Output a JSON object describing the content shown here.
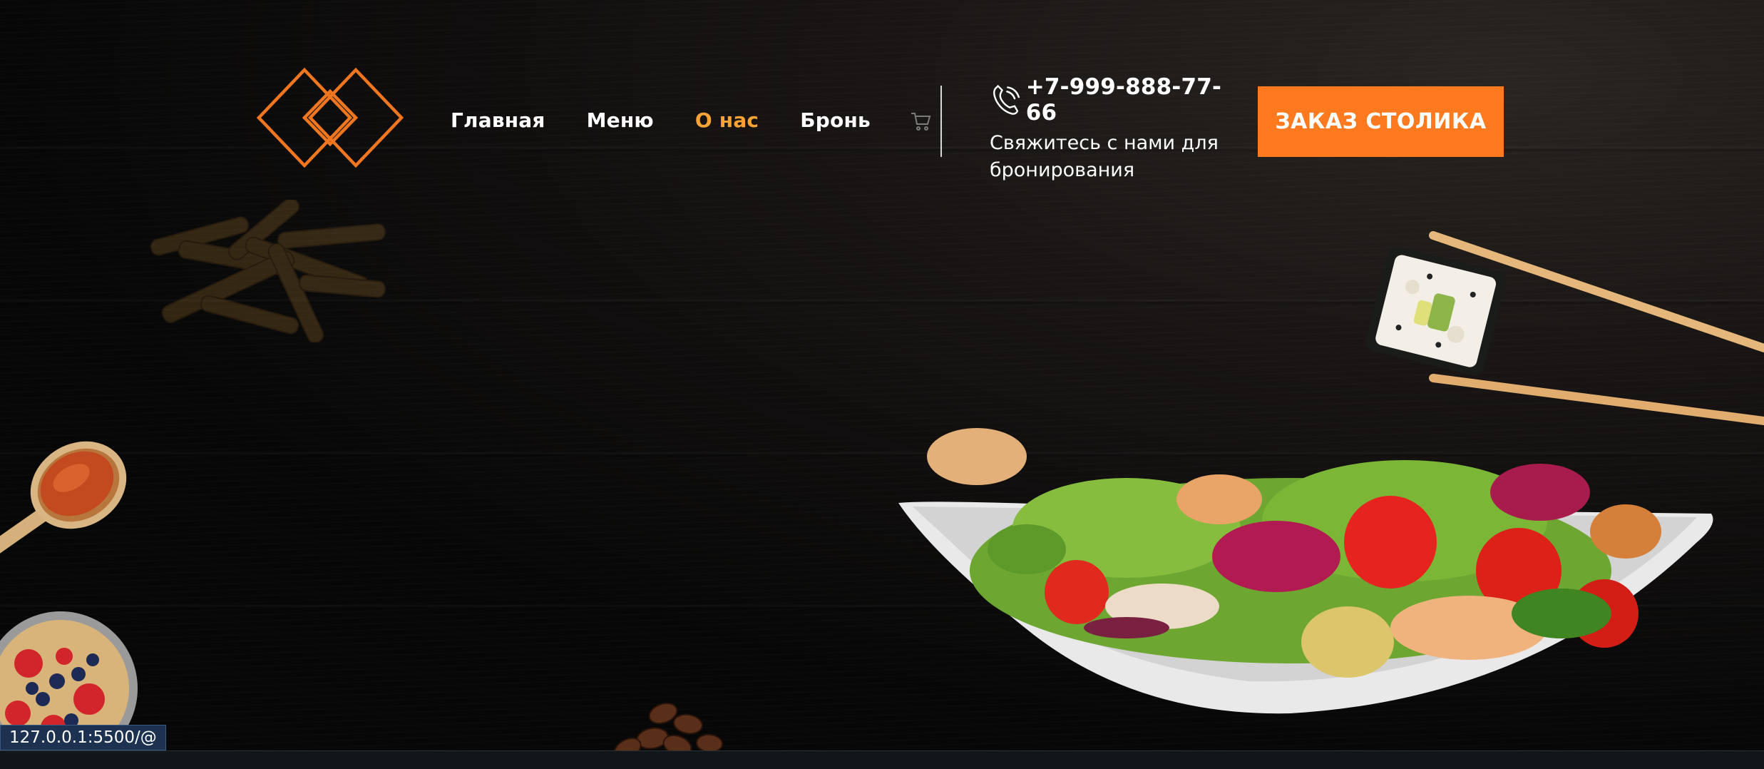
{
  "nav": {
    "items": [
      {
        "label": "Главная",
        "active": false
      },
      {
        "label": "Меню",
        "active": false
      },
      {
        "label": "О нас",
        "active": true
      },
      {
        "label": "Бронь",
        "active": false
      }
    ]
  },
  "icons": {
    "logo": "diamond-logo-icon",
    "cart": "cart-icon",
    "phone": "phone-icon"
  },
  "contact": {
    "phone": "+7-999-888-77-66",
    "text": "Свяжитесь с нами для бронирования"
  },
  "cta": {
    "label": "ЗАКАЗ СТОЛИКА"
  },
  "status_bar": {
    "url": "127.0.0.1:5500/@"
  },
  "colors": {
    "accent": "#ff7a1f",
    "active_nav": "#f7a335",
    "background": "#0b0b0b"
  }
}
